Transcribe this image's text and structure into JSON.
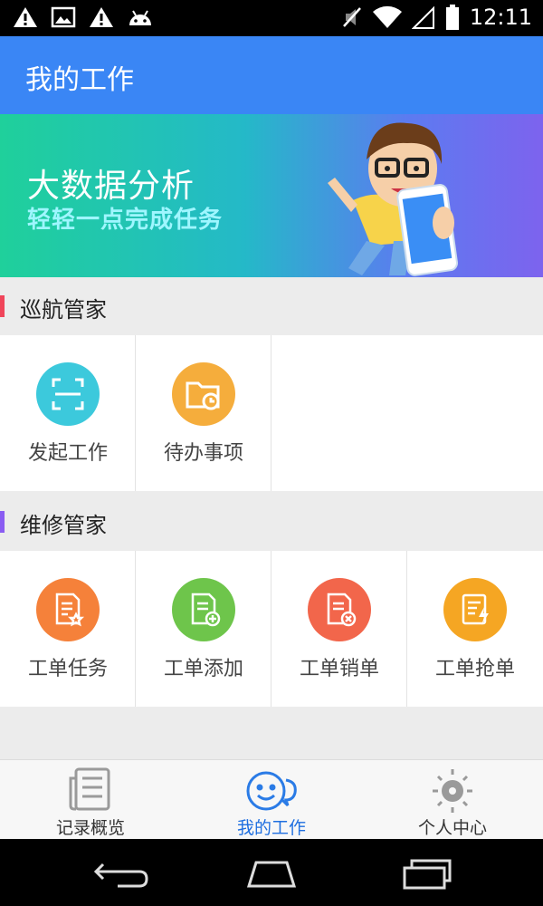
{
  "status_bar": {
    "time": "12:11",
    "left_icons": [
      "warning-icon",
      "image-icon",
      "warning-icon",
      "android-icon"
    ],
    "right_icons": [
      "mute-icon",
      "wifi-icon",
      "signal-icon",
      "battery-icon"
    ]
  },
  "app_bar": {
    "title": "我的工作",
    "color": "#3a86f5"
  },
  "banner": {
    "title": "大数据分析",
    "subtitle": "轻轻一点完成任务"
  },
  "sections": [
    {
      "title": "巡航管家",
      "accent": "#f0455a",
      "items": [
        {
          "label": "发起工作",
          "icon": "scan-icon",
          "color": "#3cc9dc"
        },
        {
          "label": "待办事项",
          "icon": "folder-clock-icon",
          "color": "#f5ad3c"
        }
      ]
    },
    {
      "title": "维修管家",
      "accent": "#8a5cf2",
      "items": [
        {
          "label": "工单任务",
          "icon": "document-star-icon",
          "color": "#f5813a"
        },
        {
          "label": "工单添加",
          "icon": "document-add-icon",
          "color": "#6ec54b"
        },
        {
          "label": "工单销单",
          "icon": "document-cancel-icon",
          "color": "#f2664b"
        },
        {
          "label": "工单抢单",
          "icon": "document-flash-icon",
          "color": "#f5a623"
        }
      ]
    }
  ],
  "bottom_nav": {
    "active": "我的工作",
    "items": [
      {
        "label": "记录概览",
        "icon": "newspaper-icon"
      },
      {
        "label": "我的工作",
        "icon": "chat-smile-icon"
      },
      {
        "label": "个人中心",
        "icon": "sun-icon"
      }
    ]
  },
  "system_nav": [
    "back-icon",
    "home-icon",
    "recent-apps-icon"
  ]
}
